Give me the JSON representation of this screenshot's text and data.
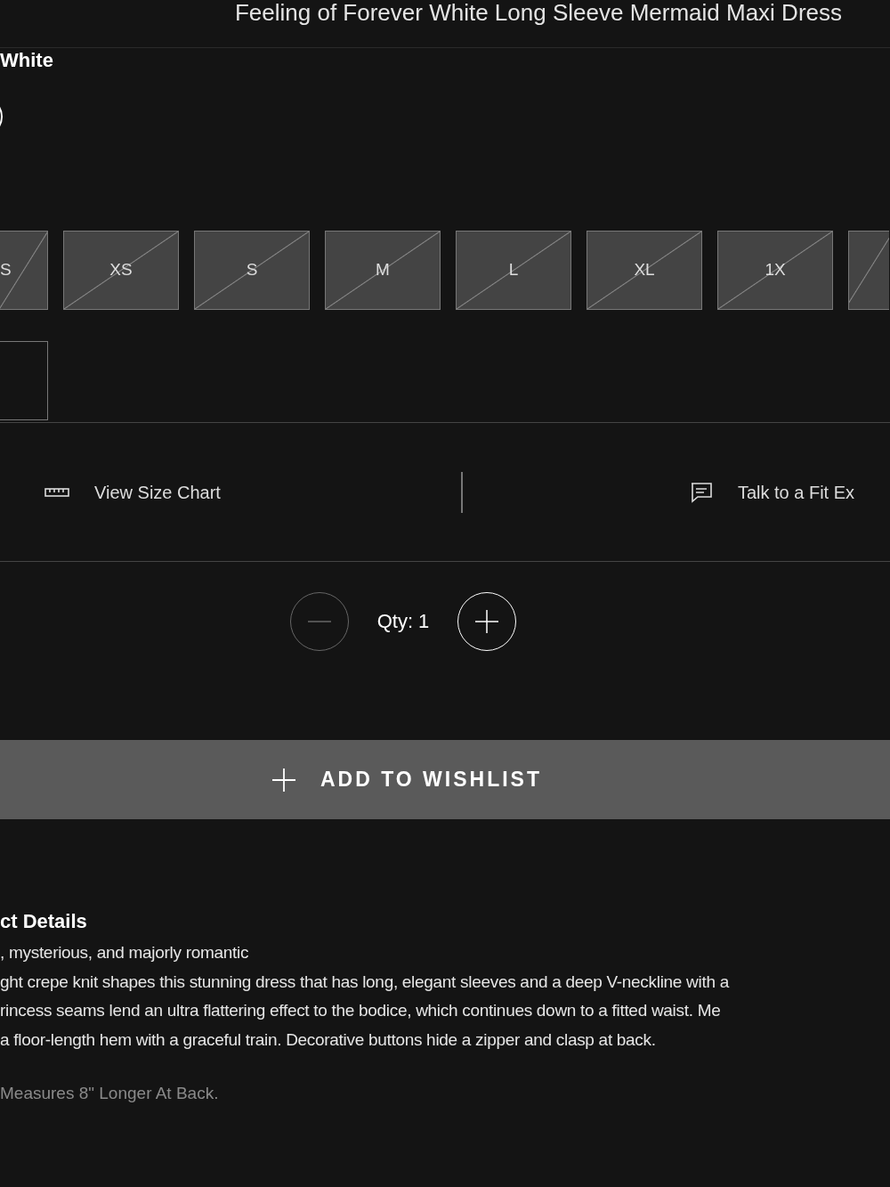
{
  "header": {
    "title": "Feeling of Forever White Long Sleeve Mermaid Maxi Dress"
  },
  "color": {
    "label": "White",
    "swatch_selected": true
  },
  "sizes": [
    {
      "label": "S",
      "available": false
    },
    {
      "label": "XS",
      "available": false
    },
    {
      "label": "S",
      "available": false
    },
    {
      "label": "M",
      "available": false
    },
    {
      "label": "L",
      "available": false
    },
    {
      "label": "XL",
      "available": false
    },
    {
      "label": "1X",
      "available": false
    },
    {
      "available": false
    },
    {
      "available": true
    }
  ],
  "links": [
    {
      "kind": "ruler",
      "label": "View Size Chart"
    },
    {
      "kind": "chat",
      "label": "Talk to a Fit Ex"
    }
  ],
  "quantity": {
    "label": "Qty: 1",
    "decrease_disabled": true
  },
  "wishlist_button": {
    "label": "ADD TO WISHLIST"
  },
  "details": {
    "heading": "ct Details",
    "lines": [
      ", mysterious, and majorly romantic",
      "ght crepe knit shapes this stunning dress that has long, elegant sleeves and a deep V-neckline with a",
      "rincess seams lend an ultra flattering effect to the bodice, which continues down to a fitted waist. Me",
      "a floor-length hem with a graceful train. Decorative buttons hide a zipper and clasp at back."
    ],
    "note": "Measures 8\" Longer At Back."
  }
}
